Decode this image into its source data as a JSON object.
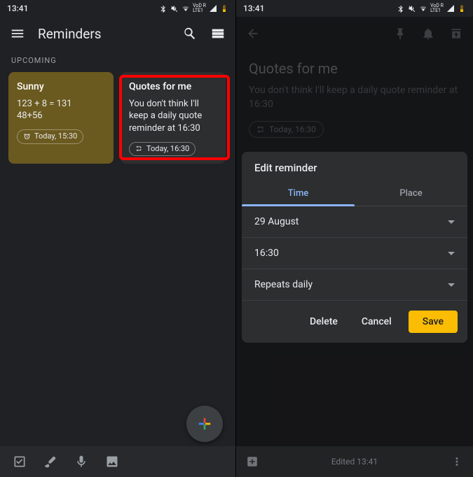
{
  "status": {
    "time": "13:41",
    "net_label": "VoD R\nLTE1"
  },
  "left": {
    "title": "Reminders",
    "section": "UPCOMING",
    "card1": {
      "title": "Sunny",
      "body": "123 + 8 = 131\n48+56",
      "chip": "Today, 15:30"
    },
    "card2": {
      "title": "Quotes for me",
      "body": "You don't think I'll keep a daily quote reminder at 16:30",
      "chip": "Today, 16:30"
    }
  },
  "right": {
    "note_title": "Quotes for me",
    "note_body": "You don't think I'll keep a daily quote reminder at 16:30",
    "note_chip": "Today, 16:30",
    "dialog": {
      "title": "Edit reminder",
      "tab_time": "Time",
      "tab_place": "Place",
      "date": "29 August",
      "time": "16:30",
      "repeat": "Repeats daily",
      "delete": "Delete",
      "cancel": "Cancel",
      "save": "Save"
    },
    "edited": "Edited 13:41"
  }
}
